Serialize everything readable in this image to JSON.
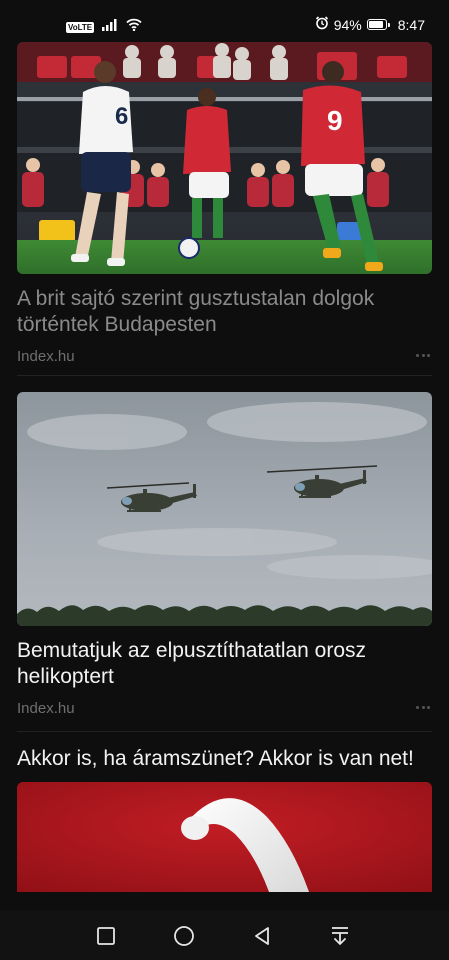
{
  "status_bar": {
    "network_badge": "VoLTE",
    "battery_percent": "94%",
    "battery_level": 0.94,
    "time": "8:47",
    "icons": [
      "signal-icon",
      "wifi-icon",
      "alarm-icon",
      "battery-icon"
    ]
  },
  "feed": {
    "articles": [
      {
        "image_label": "football-match-photo",
        "title": "A brit sajtó szerint gusztustalan dolgok történtek Budapesten",
        "source": "Index.hu",
        "read": true
      },
      {
        "image_label": "helicopters-photo",
        "title": "Bemutatjuk az elpusztíthatatlan orosz helikoptert",
        "source": "Index.hu",
        "read": false
      },
      {
        "image_label": "promo-banner",
        "title": "Akkor is, ha áramszünet? Akkor is van net!",
        "read": false
      }
    ]
  },
  "nav_bar": {
    "buttons": [
      "recents-icon",
      "home-icon",
      "back-icon",
      "notification-pulldown-icon"
    ]
  },
  "colors": {
    "background": "#0e0e0e",
    "title_read": "#8a8a8a",
    "title_unread": "#f2f2f2",
    "source_text": "#6f6f6f",
    "promo_red": "#a8151b"
  }
}
